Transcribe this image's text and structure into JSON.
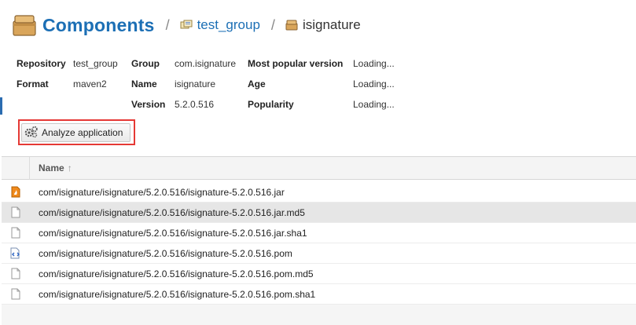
{
  "breadcrumb": {
    "title": "Components",
    "separator": "/",
    "group_link": "test_group",
    "current": "isignature"
  },
  "info": {
    "repository_label": "Repository",
    "repository_value": "test_group",
    "format_label": "Format",
    "format_value": "maven2",
    "group_label": "Group",
    "group_value": "com.isignature",
    "name_label": "Name",
    "name_value": "isignature",
    "version_label": "Version",
    "version_value": "5.2.0.516",
    "most_popular_label": "Most popular version",
    "most_popular_value": "Loading...",
    "age_label": "Age",
    "age_value": "Loading...",
    "popularity_label": "Popularity",
    "popularity_value": "Loading..."
  },
  "toolbar": {
    "analyze_label": "Analyze application"
  },
  "grid": {
    "name_header": "Name",
    "sort_arrow": "↑",
    "rows": [
      {
        "name": "com/isignature/isignature/5.2.0.516/isignature-5.2.0.516.jar",
        "icon": "jar-file-icon"
      },
      {
        "name": "com/isignature/isignature/5.2.0.516/isignature-5.2.0.516.jar.md5",
        "icon": "file-icon"
      },
      {
        "name": "com/isignature/isignature/5.2.0.516/isignature-5.2.0.516.jar.sha1",
        "icon": "file-icon"
      },
      {
        "name": "com/isignature/isignature/5.2.0.516/isignature-5.2.0.516.pom",
        "icon": "xml-file-icon"
      },
      {
        "name": "com/isignature/isignature/5.2.0.516/isignature-5.2.0.516.pom.md5",
        "icon": "file-icon"
      },
      {
        "name": "com/isignature/isignature/5.2.0.516/isignature-5.2.0.516.pom.sha1",
        "icon": "file-icon"
      }
    ]
  },
  "colors": {
    "title_blue": "#1c6fb5",
    "highlight_red": "#e53935",
    "selected_row": "#e6e6e6",
    "jar_orange": "#f08a1c"
  }
}
